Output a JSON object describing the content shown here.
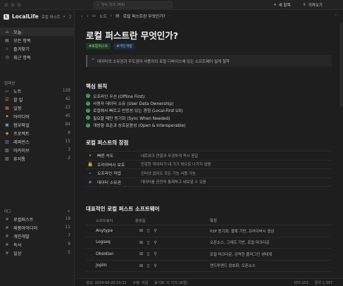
{
  "topbar": {
    "search_placeholder": "항목 검색 (⌘K)",
    "new_item": "새 항목",
    "import": "가져오기"
  },
  "sidebar": {
    "app_name": "LocalLife",
    "workspace": "로컬 퍼스트",
    "main": [
      {
        "icon": "home-icon",
        "glyph": "⌂",
        "label": "오늘"
      },
      {
        "icon": "stack-icon",
        "glyph": "▤",
        "label": "모든 항목"
      },
      {
        "icon": "star-icon",
        "glyph": "☆",
        "label": "즐겨찾기"
      },
      {
        "icon": "clock-icon",
        "glyph": "◷",
        "label": "최근 항목"
      }
    ],
    "categories_title": "컬렉션",
    "categories": [
      {
        "icon": "note-icon",
        "glyph": "▭",
        "color": "#6fa8dc",
        "label": "노트",
        "count": "128"
      },
      {
        "icon": "todo-icon",
        "glyph": "☑",
        "color": "#e0a050",
        "label": "할 일",
        "count": "42"
      },
      {
        "icon": "calendar-icon",
        "glyph": "▦",
        "color": "#e06666",
        "label": "일정",
        "count": "23"
      },
      {
        "icon": "idea-icon",
        "glyph": "✦",
        "color": "#f1c232",
        "label": "아이디어",
        "count": "45"
      },
      {
        "icon": "file-icon",
        "glyph": "▣",
        "color": "#6fa8dc",
        "label": "첨부파일",
        "count": "84"
      },
      {
        "icon": "project-icon",
        "glyph": "◆",
        "color": "#e07b39",
        "label": "프로젝트",
        "count": "8"
      },
      {
        "icon": "reference-icon",
        "glyph": "▥",
        "color": "#8e7cc3",
        "label": "레퍼런스",
        "count": "15"
      },
      {
        "icon": "archive-icon",
        "glyph": "▧",
        "color": "#9a9a9a",
        "label": "아카이브",
        "count": "3"
      },
      {
        "icon": "trash-icon",
        "glyph": "▨",
        "color": "#9a9a9a",
        "label": "휴지통",
        "count": "2"
      }
    ],
    "tags_title": "태그",
    "tags": [
      {
        "label": "로컬퍼스트",
        "count": "19"
      },
      {
        "label": "제품아이디어",
        "count": "11"
      },
      {
        "label": "개인개발",
        "count": "7"
      },
      {
        "label": "독서",
        "count": "9"
      },
      {
        "label": "일상",
        "count": "5"
      }
    ]
  },
  "main": {
    "breadcrumb": [
      "노트",
      "로컬 퍼스트란 무엇인가?"
    ],
    "title": "로컬 퍼스트란 무엇인가?",
    "tags": [
      "#로컬퍼스트",
      "#개인개발"
    ],
    "quote": "데이터의 소유권과 주도권이 사용자의 로컬 디바이스에 있는 소프트웨어 설계 철학",
    "principles_title": "핵심 원칙",
    "principles": [
      "오프라인 우선 (Offline First)",
      "사용자 데이터 소유 (User Data Ownership)",
      "로컬에서 빠르고 반응성 있는 경험 (Local-First UX)",
      "필요할 때만 동기화 (Sync When Needed)",
      "개방형 표준과 상호운용성 (Open & Interoperable)"
    ],
    "benefits_title": "로컬 퍼스트의 장점",
    "benefits": [
      {
        "icon": "bolt-icon",
        "glyph": "⚡",
        "color": "#f1c232",
        "name": "빠른 속도",
        "desc": "네트워크 연결과 무관하게 즉시 응답"
      },
      {
        "icon": "lock-icon",
        "glyph": "🔒",
        "color": "#e0a050",
        "name": "프라이버시 보호",
        "desc": "민감한 데이터가 내 기기 밖으로 나가지 않음"
      },
      {
        "icon": "wifi-off-icon",
        "glyph": "⌁",
        "color": "#6fa8dc",
        "name": "오프라인 작업",
        "desc": "인터넷 없이도 모든 기능 사용 가능"
      },
      {
        "icon": "database-icon",
        "glyph": "◈",
        "color": "#8e7cc3",
        "name": "데이터 소유권",
        "desc": "데이터를 완전히 통제하고 내보낼 수 있음"
      }
    ],
    "software_title": "대표적인 로컬 퍼스트 소프트웨어",
    "software_headers": [
      "소프트웨어",
      "플랫폼",
      "특징"
    ],
    "software": [
      {
        "name": "Anytype",
        "platforms": [
          "",
          "⊞",
          "▯",
          "⚲"
        ],
        "feature": "P2P 동기화, 블록 기반, 프라이버시 중심"
      },
      {
        "name": "Logseq",
        "platforms": [
          "",
          "⊞",
          "▯",
          "⚲"
        ],
        "feature": "오픈소스, 그래프 기반, 로컬 마크다운"
      },
      {
        "name": "Obsidian",
        "platforms": [
          "",
          "⊞",
          "▯",
          "⚲"
        ],
        "feature": "로컬 마크다운, 강력한 플러그인 생태계"
      },
      {
        "name": "Joplin",
        "platforms": [
          "",
          "⊞",
          "▯",
          "⚲"
        ],
        "feature": "엔드투엔드 암호화, 오픈소스"
      }
    ],
    "status": {
      "created": "생성: 2024-04-20 14:32",
      "modified": "수정: 지금",
      "sync": "동기화: 이 기기 (로컬)",
      "words": "단어 253",
      "chars": "문자 1,397"
    }
  }
}
